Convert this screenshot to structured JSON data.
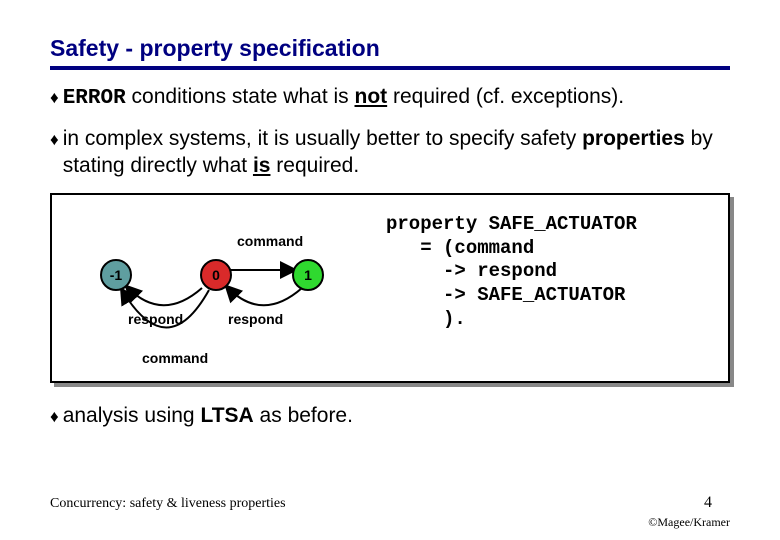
{
  "title": "Safety - property specification",
  "bullets": {
    "b1_pre": "ERROR",
    "b1_rest": " conditions state what is ",
    "b1_not": "not",
    "b1_tail": " required (cf. exceptions).",
    "b2_pre": " in complex systems, it is usually better to specify safety ",
    "b2_prop": "properties",
    "b2_mid": "  by stating directly what ",
    "b2_is": "is",
    "b2_tail": " required.",
    "b3": "  analysis using ",
    "b3_ltsa": "LTSA",
    "b3_tail": " as before."
  },
  "graph": {
    "nodes": {
      "neg1": "-1",
      "zero": "0",
      "one": "1"
    },
    "labels": {
      "command_top": "command",
      "respond_left": "respond",
      "respond_mid": "respond",
      "command_bottom": "command"
    }
  },
  "code": {
    "l1": "property SAFE_ACTUATOR",
    "l2": "   = (command",
    "l3": "     -> respond",
    "l4": "     -> SAFE_ACTUATOR",
    "l5": "     )."
  },
  "footer": "Concurrency: safety & liveness properties",
  "page": "4",
  "copyright": "©Magee/Kramer"
}
